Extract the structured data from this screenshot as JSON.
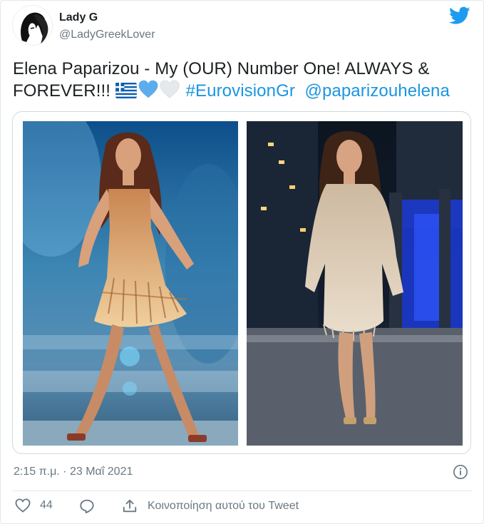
{
  "author": {
    "display_name": "Lady G",
    "handle": "@LadyGreekLover",
    "avatar_icon": "woman-silhouette-avatar"
  },
  "tweet": {
    "text_main": "Elena Paparizou - My (OUR) Number One! ALWAYS & FOREVER!!! ",
    "emojis": [
      "greek-flag-icon",
      "blue-heart-icon",
      "white-heart-icon"
    ],
    "hashtag": "#EurovisionGr",
    "mention": "@paparizouhelena"
  },
  "media": {
    "photos": [
      {
        "name": "photo-left-eurovision-performance",
        "palette": "stage-blue"
      },
      {
        "name": "photo-right-night-performance",
        "palette": "night-dark"
      }
    ]
  },
  "footer": {
    "timestamp": "2:15 π.μ. · 23 Μαΐ 2021",
    "like_count": "44",
    "share_label": "Κοινοποίηση αυτού του Tweet"
  },
  "colors": {
    "accent": "#1b95e0",
    "twitter_blue": "#1d9bf0",
    "muted": "#697882",
    "border": "#e1e8ed"
  }
}
